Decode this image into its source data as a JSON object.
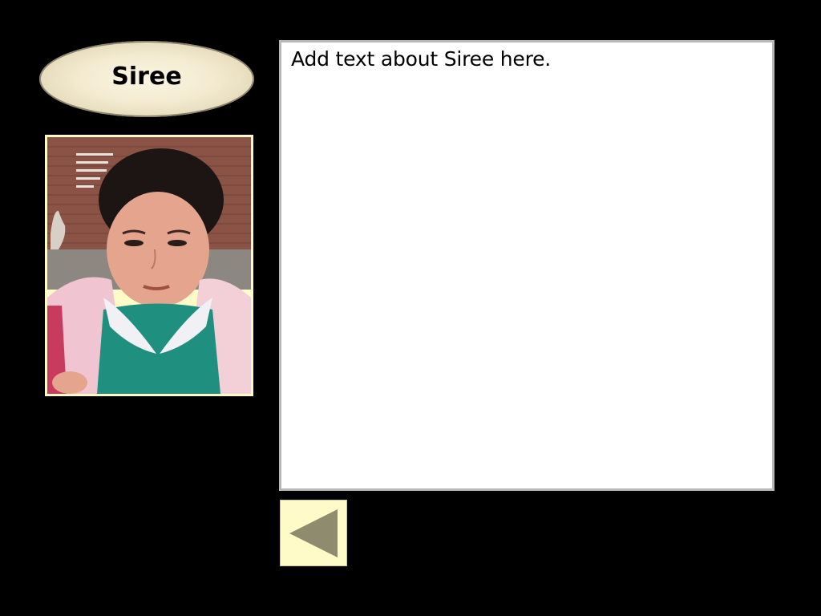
{
  "title": {
    "name": "Siree"
  },
  "photo": {
    "subject": "student-portrait-icon"
  },
  "content": {
    "text": "Add text about Siree here."
  },
  "navigation": {
    "back_icon": "left-triangle-arrow-icon"
  },
  "colors": {
    "background": "#000000",
    "oval_fill": "#f3ead0",
    "frame_fill": "#fffbc8",
    "text_box_border": "#b8b8b8",
    "arrow_fill": "#8f8b6f"
  }
}
